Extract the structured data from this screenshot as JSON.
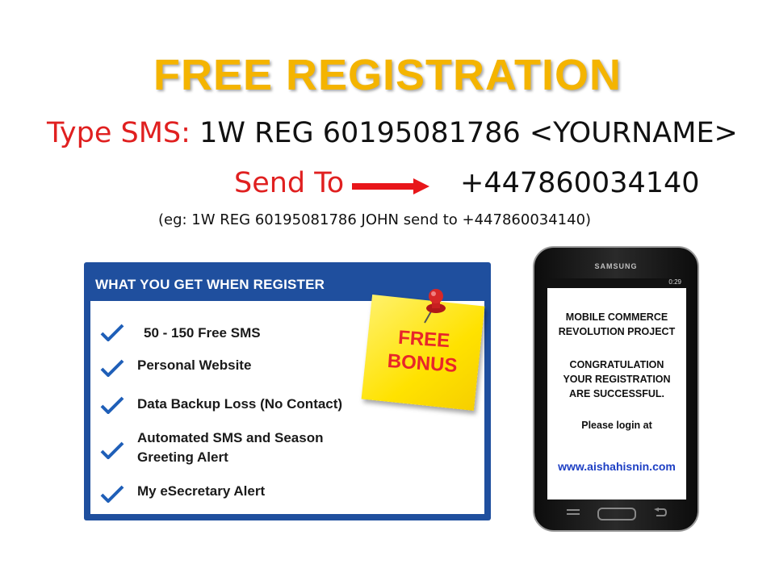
{
  "title": "FREE REGISTRATION",
  "sms": {
    "label": "Type SMS:",
    "text": "1W REG 60195081786 <YOURNAME>"
  },
  "send": {
    "label": "Send To",
    "number": "+447860034140"
  },
  "example": "(eg: 1W REG 60195081786  JOHN send to +447860034140)",
  "panel": {
    "header": "WHAT YOU GET WHEN REGISTER",
    "items": [
      "50 - 150 Free SMS",
      "Personal Website",
      "Data Backup Loss (No Contact)",
      "Automated SMS and Season",
      "Greeting Alert",
      "My eSecretary Alert"
    ],
    "bonus_line1": "FREE",
    "bonus_line2": "BONUS"
  },
  "phone": {
    "brand": "SAMSUNG",
    "status": "0:29",
    "screen": {
      "line1": "MOBILE COMMERCE",
      "line2": "REVOLUTION PROJECT",
      "line3": "CONGRATULATION",
      "line4": "YOUR REGISTRATION",
      "line5": "ARE SUCCESSFUL.",
      "line6": "Please login at",
      "url": "www.aishahisnin.com"
    }
  },
  "colors": {
    "title": "#f4b400",
    "red": "#e02020",
    "panel_blue": "#1f4f9e",
    "note_yellow": "#ffe200",
    "url_blue": "#1d3fc4"
  }
}
